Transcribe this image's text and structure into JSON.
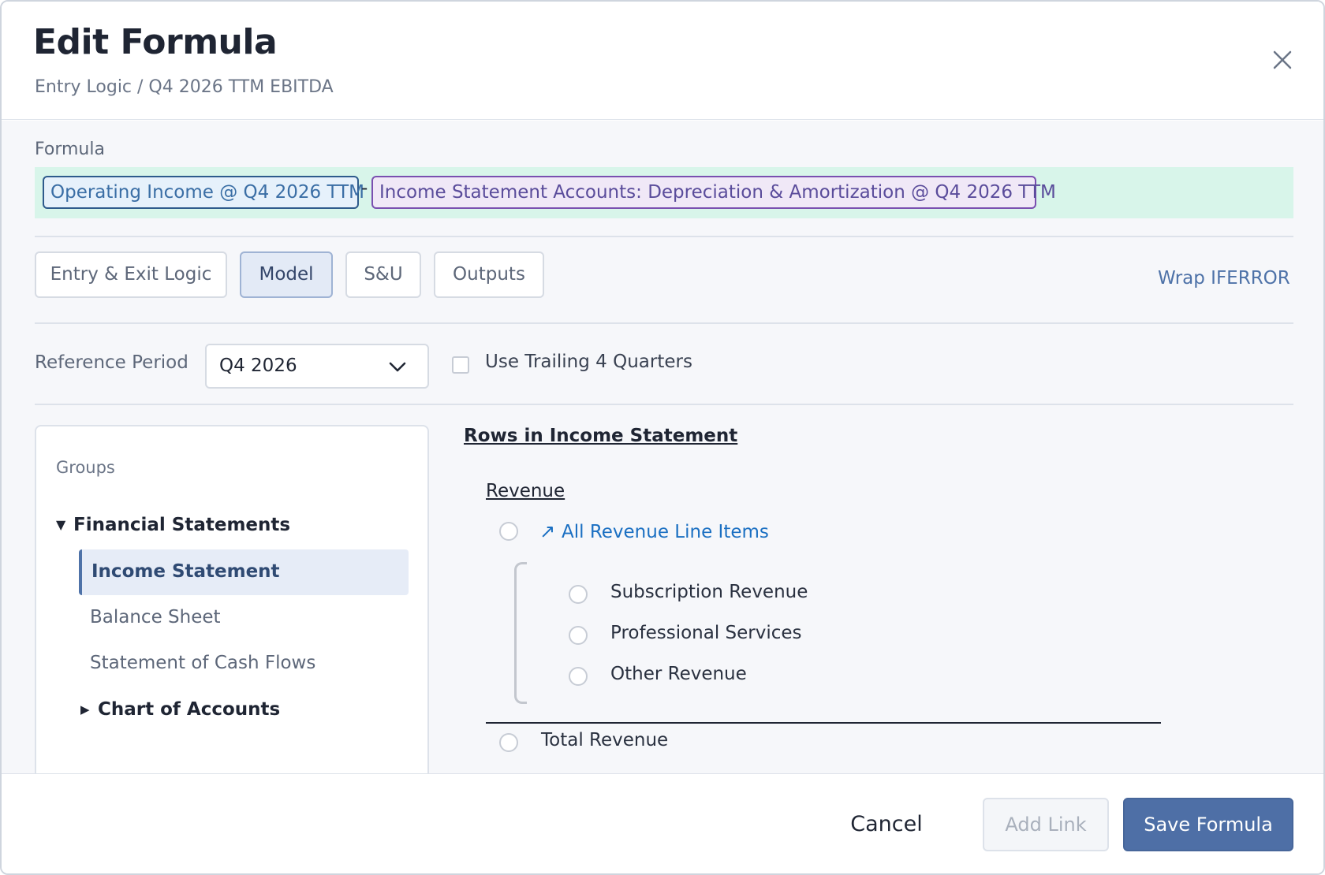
{
  "header": {
    "title": "Edit Formula",
    "breadcrumb": "Entry Logic / Q4 2026 TTM EBITDA",
    "close_icon": "close-icon"
  },
  "formula": {
    "label": "Formula",
    "tokens": [
      {
        "text": "Operating Income @ Q4 2026 TTM",
        "color": "#2e5b8c"
      },
      {
        "text": "-"
      },
      {
        "text": "Income Statement Accounts: Depreciation & Amortization @ Q4 2026 TTM",
        "color": "#7a4fb0"
      }
    ],
    "bar_color": "#d8f5ea"
  },
  "tabs": [
    {
      "label": "Entry & Exit Logic",
      "active": false
    },
    {
      "label": "Model",
      "active": true
    },
    {
      "label": "S&U",
      "active": false
    },
    {
      "label": "Outputs",
      "active": false
    }
  ],
  "wrap_link": "Wrap IFERROR",
  "reference": {
    "label": "Reference Period",
    "selected": "Q4 2026",
    "trailing_label": "Use Trailing 4 Quarters",
    "trailing_checked": false
  },
  "groups": {
    "title": "Groups",
    "parent": "Financial Statements",
    "items": [
      {
        "label": "Income Statement",
        "active": true
      },
      {
        "label": "Balance Sheet",
        "active": false
      },
      {
        "label": "Statement of Cash Flows",
        "active": false
      }
    ],
    "collapsed": "Chart of Accounts"
  },
  "rows": {
    "title": "Rows in Income Statement",
    "section": "Revenue",
    "link_item": "All Revenue Line Items",
    "children": [
      "Subscription Revenue",
      "Professional Services",
      "Other Revenue"
    ],
    "total": "Total Revenue"
  },
  "footer": {
    "cancel": "Cancel",
    "add_link": "Add Link",
    "save": "Save Formula"
  },
  "colors": {
    "accent": "#4e6fa6",
    "link": "#1a6fc2"
  }
}
